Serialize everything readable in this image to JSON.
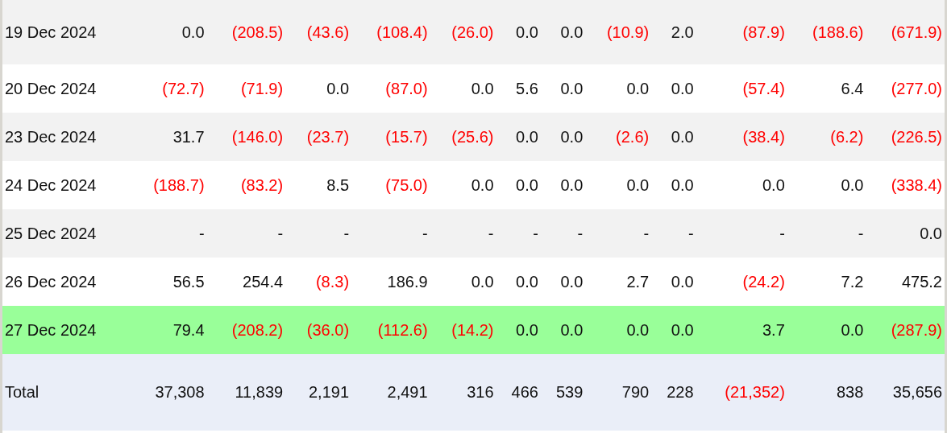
{
  "table": {
    "rows": [
      {
        "date": "19 Dec 2024",
        "highlighted": false,
        "cells": [
          {
            "text": "0.0",
            "negative": false
          },
          {
            "text": "(208.5)",
            "negative": true
          },
          {
            "text": "(43.6)",
            "negative": true
          },
          {
            "text": "(108.4)",
            "negative": true
          },
          {
            "text": "(26.0)",
            "negative": true
          },
          {
            "text": "0.0",
            "negative": false
          },
          {
            "text": "0.0",
            "negative": false
          },
          {
            "text": "(10.9)",
            "negative": true
          },
          {
            "text": "2.0",
            "negative": false
          },
          {
            "text": "(87.9)",
            "negative": true
          },
          {
            "text": "(188.6)",
            "negative": true
          },
          {
            "text": "(671.9)",
            "negative": true
          }
        ]
      },
      {
        "date": "20 Dec 2024",
        "highlighted": false,
        "cells": [
          {
            "text": "(72.7)",
            "negative": true
          },
          {
            "text": "(71.9)",
            "negative": true
          },
          {
            "text": "0.0",
            "negative": false
          },
          {
            "text": "(87.0)",
            "negative": true
          },
          {
            "text": "0.0",
            "negative": false
          },
          {
            "text": "5.6",
            "negative": false
          },
          {
            "text": "0.0",
            "negative": false
          },
          {
            "text": "0.0",
            "negative": false
          },
          {
            "text": "0.0",
            "negative": false
          },
          {
            "text": "(57.4)",
            "negative": true
          },
          {
            "text": "6.4",
            "negative": false
          },
          {
            "text": "(277.0)",
            "negative": true
          }
        ]
      },
      {
        "date": "23 Dec 2024",
        "highlighted": false,
        "cells": [
          {
            "text": "31.7",
            "negative": false
          },
          {
            "text": "(146.0)",
            "negative": true
          },
          {
            "text": "(23.7)",
            "negative": true
          },
          {
            "text": "(15.7)",
            "negative": true
          },
          {
            "text": "(25.6)",
            "negative": true
          },
          {
            "text": "0.0",
            "negative": false
          },
          {
            "text": "0.0",
            "negative": false
          },
          {
            "text": "(2.6)",
            "negative": true
          },
          {
            "text": "0.0",
            "negative": false
          },
          {
            "text": "(38.4)",
            "negative": true
          },
          {
            "text": "(6.2)",
            "negative": true
          },
          {
            "text": "(226.5)",
            "negative": true
          }
        ]
      },
      {
        "date": "24 Dec 2024",
        "highlighted": false,
        "cells": [
          {
            "text": "(188.7)",
            "negative": true
          },
          {
            "text": "(83.2)",
            "negative": true
          },
          {
            "text": "8.5",
            "negative": false
          },
          {
            "text": "(75.0)",
            "negative": true
          },
          {
            "text": "0.0",
            "negative": false
          },
          {
            "text": "0.0",
            "negative": false
          },
          {
            "text": "0.0",
            "negative": false
          },
          {
            "text": "0.0",
            "negative": false
          },
          {
            "text": "0.0",
            "negative": false
          },
          {
            "text": "0.0",
            "negative": false
          },
          {
            "text": "0.0",
            "negative": false
          },
          {
            "text": "(338.4)",
            "negative": true
          }
        ]
      },
      {
        "date": "25 Dec 2024",
        "highlighted": false,
        "cells": [
          {
            "text": "-",
            "negative": false
          },
          {
            "text": "-",
            "negative": false
          },
          {
            "text": "-",
            "negative": false
          },
          {
            "text": "-",
            "negative": false
          },
          {
            "text": "-",
            "negative": false
          },
          {
            "text": "-",
            "negative": false
          },
          {
            "text": "-",
            "negative": false
          },
          {
            "text": "-",
            "negative": false
          },
          {
            "text": "-",
            "negative": false
          },
          {
            "text": "-",
            "negative": false
          },
          {
            "text": "-",
            "negative": false
          },
          {
            "text": "0.0",
            "negative": false
          }
        ]
      },
      {
        "date": "26 Dec 2024",
        "highlighted": false,
        "cells": [
          {
            "text": "56.5",
            "negative": false
          },
          {
            "text": "254.4",
            "negative": false
          },
          {
            "text": "(8.3)",
            "negative": true
          },
          {
            "text": "186.9",
            "negative": false
          },
          {
            "text": "0.0",
            "negative": false
          },
          {
            "text": "0.0",
            "negative": false
          },
          {
            "text": "0.0",
            "negative": false
          },
          {
            "text": "2.7",
            "negative": false
          },
          {
            "text": "0.0",
            "negative": false
          },
          {
            "text": "(24.2)",
            "negative": true
          },
          {
            "text": "7.2",
            "negative": false
          },
          {
            "text": "475.2",
            "negative": false
          }
        ]
      },
      {
        "date": "27 Dec 2024",
        "highlighted": true,
        "cells": [
          {
            "text": "79.4",
            "negative": false
          },
          {
            "text": "(208.2)",
            "negative": true
          },
          {
            "text": "(36.0)",
            "negative": true
          },
          {
            "text": "(112.6)",
            "negative": true
          },
          {
            "text": "(14.2)",
            "negative": true
          },
          {
            "text": "0.0",
            "negative": false
          },
          {
            "text": "0.0",
            "negative": false
          },
          {
            "text": "0.0",
            "negative": false
          },
          {
            "text": "0.0",
            "negative": false
          },
          {
            "text": "3.7",
            "negative": false
          },
          {
            "text": "0.0",
            "negative": false
          },
          {
            "text": "(287.9)",
            "negative": true
          }
        ]
      }
    ],
    "total": {
      "label": "Total",
      "cells": [
        {
          "text": "37,308",
          "negative": false
        },
        {
          "text": "11,839",
          "negative": false
        },
        {
          "text": "2,191",
          "negative": false
        },
        {
          "text": "2,491",
          "negative": false
        },
        {
          "text": "316",
          "negative": false
        },
        {
          "text": "466",
          "negative": false
        },
        {
          "text": "539",
          "negative": false
        },
        {
          "text": "790",
          "negative": false
        },
        {
          "text": "228",
          "negative": false
        },
        {
          "text": "(21,352)",
          "negative": true
        },
        {
          "text": "838",
          "negative": false
        },
        {
          "text": "35,656",
          "negative": false
        }
      ]
    }
  }
}
